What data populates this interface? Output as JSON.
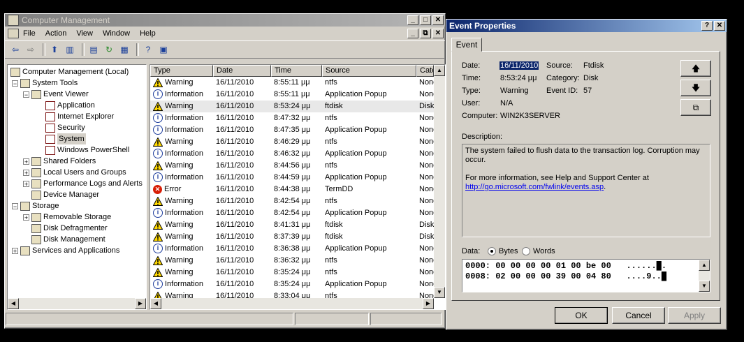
{
  "cm_window": {
    "title": "Computer Management",
    "menu": [
      "File",
      "Action",
      "View",
      "Window",
      "Help"
    ],
    "tree": [
      {
        "label": "Computer Management (Local)",
        "level": 0
      },
      {
        "label": "System Tools",
        "level": 1
      },
      {
        "label": "Event Viewer",
        "level": 2
      },
      {
        "label": "Application",
        "level": 3
      },
      {
        "label": "Internet Explorer",
        "level": 3
      },
      {
        "label": "Security",
        "level": 3
      },
      {
        "label": "System",
        "level": 3
      },
      {
        "label": "Windows PowerShell",
        "level": 3
      },
      {
        "label": "Shared Folders",
        "level": 2
      },
      {
        "label": "Local Users and Groups",
        "level": 2
      },
      {
        "label": "Performance Logs and Alerts",
        "level": 2
      },
      {
        "label": "Device Manager",
        "level": 2
      },
      {
        "label": "Storage",
        "level": 1
      },
      {
        "label": "Removable Storage",
        "level": 2
      },
      {
        "label": "Disk Defragmenter",
        "level": 2
      },
      {
        "label": "Disk Management",
        "level": 2
      },
      {
        "label": "Services and Applications",
        "level": 1
      }
    ],
    "columns": [
      "Type",
      "Date",
      "Time",
      "Source",
      "Cate"
    ],
    "events": [
      {
        "type": "Warning",
        "date": "16/11/2010",
        "time": "8:55:11 μμ",
        "source": "ntfs",
        "cat": "None"
      },
      {
        "type": "Information",
        "date": "16/11/2010",
        "time": "8:55:11 μμ",
        "source": "Application Popup",
        "cat": "None"
      },
      {
        "type": "Warning",
        "date": "16/11/2010",
        "time": "8:53:24 μμ",
        "source": "ftdisk",
        "cat": "Disk"
      },
      {
        "type": "Information",
        "date": "16/11/2010",
        "time": "8:47:32 μμ",
        "source": "ntfs",
        "cat": "None"
      },
      {
        "type": "Information",
        "date": "16/11/2010",
        "time": "8:47:35 μμ",
        "source": "Application Popup",
        "cat": "None"
      },
      {
        "type": "Warning",
        "date": "16/11/2010",
        "time": "8:46:29 μμ",
        "source": "ntfs",
        "cat": "None"
      },
      {
        "type": "Information",
        "date": "16/11/2010",
        "time": "8:46:32 μμ",
        "source": "Application Popup",
        "cat": "None"
      },
      {
        "type": "Warning",
        "date": "16/11/2010",
        "time": "8:44:56 μμ",
        "source": "ntfs",
        "cat": "None"
      },
      {
        "type": "Information",
        "date": "16/11/2010",
        "time": "8:44:59 μμ",
        "source": "Application Popup",
        "cat": "None"
      },
      {
        "type": "Error",
        "date": "16/11/2010",
        "time": "8:44:38 μμ",
        "source": "TermDD",
        "cat": "None"
      },
      {
        "type": "Warning",
        "date": "16/11/2010",
        "time": "8:42:54 μμ",
        "source": "ntfs",
        "cat": "None"
      },
      {
        "type": "Information",
        "date": "16/11/2010",
        "time": "8:42:54 μμ",
        "source": "Application Popup",
        "cat": "None"
      },
      {
        "type": "Warning",
        "date": "16/11/2010",
        "time": "8:41:31 μμ",
        "source": "ftdisk",
        "cat": "Disk"
      },
      {
        "type": "Warning",
        "date": "16/11/2010",
        "time": "8:37:39 μμ",
        "source": "ftdisk",
        "cat": "Disk"
      },
      {
        "type": "Information",
        "date": "16/11/2010",
        "time": "8:36:38 μμ",
        "source": "Application Popup",
        "cat": "None"
      },
      {
        "type": "Warning",
        "date": "16/11/2010",
        "time": "8:36:32 μμ",
        "source": "ntfs",
        "cat": "None"
      },
      {
        "type": "Warning",
        "date": "16/11/2010",
        "time": "8:35:24 μμ",
        "source": "ntfs",
        "cat": "None"
      },
      {
        "type": "Information",
        "date": "16/11/2010",
        "time": "8:35:24 μμ",
        "source": "Application Popup",
        "cat": "None"
      },
      {
        "type": "Warning",
        "date": "16/11/2010",
        "time": "8:33:04 μμ",
        "source": "ntfs",
        "cat": "None"
      }
    ]
  },
  "props": {
    "title": "Event Properties",
    "tab": "Event",
    "date_label": "Date:",
    "date": "16/11/2010",
    "source_label": "Source:",
    "source": "Ftdisk",
    "time_label": "Time:",
    "time": "8:53:24 μμ",
    "category_label": "Category:",
    "category": "Disk",
    "type_label": "Type:",
    "type": "Warning",
    "eventid_label": "Event ID:",
    "eventid": "57",
    "user_label": "User:",
    "user": "N/A",
    "computer_label": "Computer:",
    "computer": "WIN2K3SERVER",
    "description_label": "Description:",
    "desc_line1": "The system failed to flush data to the transaction log. Corruption may occur.",
    "desc_line2": "For more information, see Help and Support Center at",
    "desc_link": "http://go.microsoft.com/fwlink/events.asp",
    "desc_end": ".",
    "data_label": "Data:",
    "bytes_label": "Bytes",
    "words_label": "Words",
    "hex_line1": "0000: 00 00 00 00 01 00 be 00   ......█.",
    "hex_line2": "0008: 02 00 00 00 39 00 04 80   ....9..█",
    "ok": "OK",
    "cancel": "Cancel",
    "apply": "Apply"
  }
}
